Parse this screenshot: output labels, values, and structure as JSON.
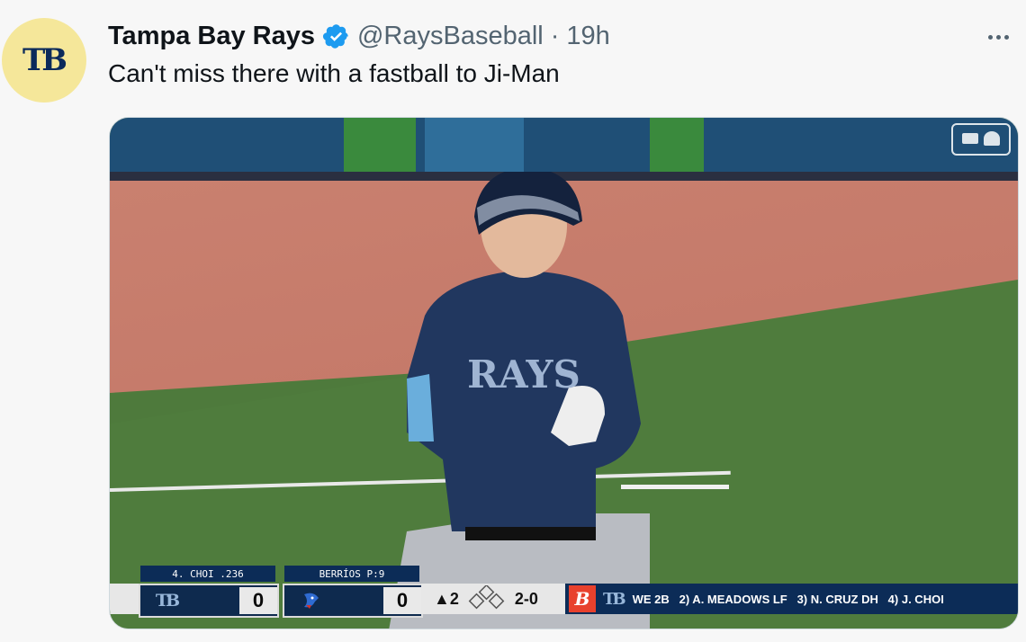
{
  "tweet": {
    "author_name": "Tampa Bay Rays",
    "handle": "@RaysBaseball",
    "separator": "·",
    "time": "19h",
    "text": "Can't miss there with a fastball to Ji-Man",
    "avatar_logo": "TB",
    "verified_icon": "verified-badge-icon",
    "more_icon": "more-options-icon"
  },
  "colors": {
    "verified": "#1d9bf0",
    "avatar_bg": "#f5e79a",
    "rays_navy": "#0c2c57"
  },
  "scorebug": {
    "away_label": "4. CHOI .236",
    "away_logo": "TB",
    "away_score": "0",
    "home_label": "BERRÍOS P:9",
    "home_logo": "blue-jays-logo",
    "home_score": "0",
    "inning": "▲2",
    "count": "2-0",
    "sponsor_logo": "B",
    "ticker_logo": "TB",
    "ticker": "WE 2B   2) A. MEADOWS LF   3) N. CRUZ DH   4) J. CHOI"
  }
}
